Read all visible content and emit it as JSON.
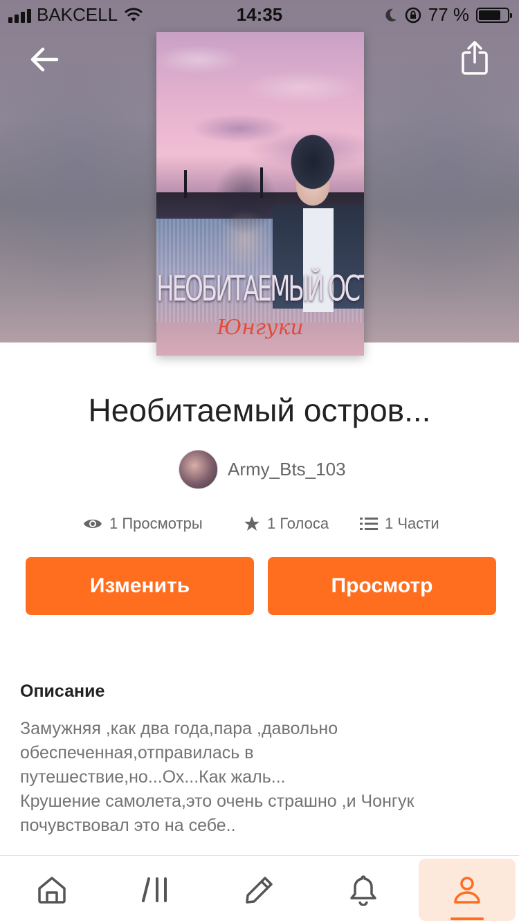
{
  "status_bar": {
    "carrier": "BAKCELL",
    "time": "14:35",
    "battery_text": "77 %",
    "battery_level": 0.77
  },
  "header": {
    "back_icon": "arrow-left-icon",
    "share_icon": "share-icon"
  },
  "cover": {
    "title_text": "НЕОБИТАЕМЫЙ ОСТРОВ..",
    "author_text": "Юнгуки"
  },
  "story": {
    "title": "Необитаемый остров...",
    "author": "Army_Bts_103",
    "stats": {
      "views": "1 Просмотры",
      "votes": "1 Голоса",
      "parts": "1 Части"
    }
  },
  "actions": {
    "edit_label": "Изменить",
    "view_label": "Просмотр"
  },
  "description": {
    "heading": "Описание",
    "text": "Замужняя ,как два года,пара ,давольно\nобеспеченная,отправилась в\nпутешествие,но...Ох...Как жаль...\nКрушение самолета,это очень страшно ,и Чонгук\nпочувствовал это на себе.."
  },
  "bottom_nav": {
    "items": [
      {
        "icon": "home-icon"
      },
      {
        "icon": "library-icon"
      },
      {
        "icon": "pencil-icon"
      },
      {
        "icon": "bell-icon"
      },
      {
        "icon": "profile-icon",
        "active": true
      }
    ]
  },
  "colors": {
    "accent": "#ff6d1f",
    "active_nav_bg": "#fde8dc",
    "text_primary": "#222222",
    "text_secondary": "#737373"
  }
}
